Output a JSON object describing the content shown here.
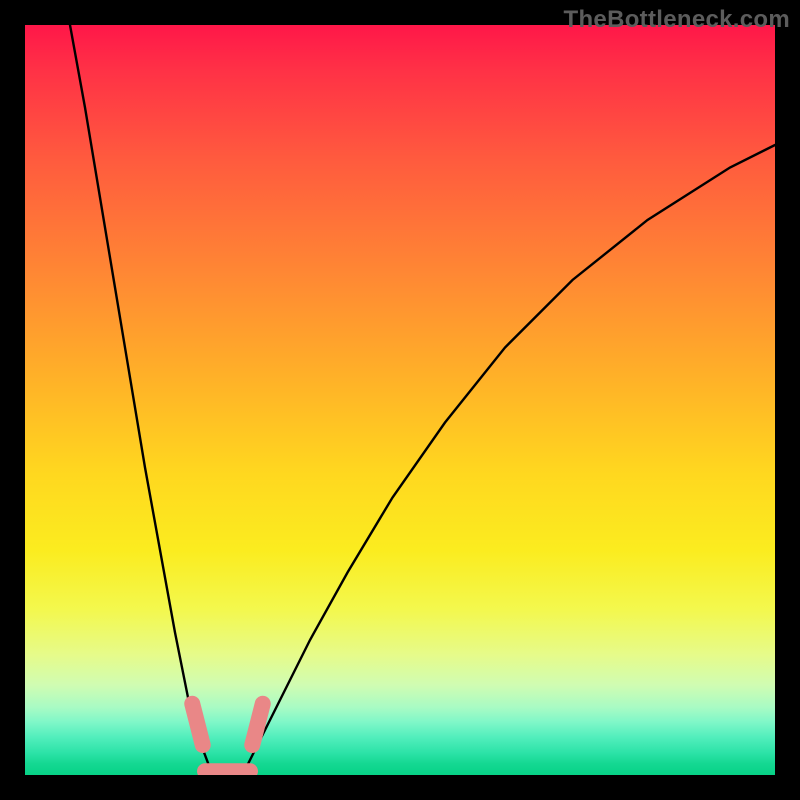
{
  "watermark": "TheBottleneck.com",
  "colors": {
    "frame": "#000000",
    "curve": "#000000",
    "marker": "#e98787"
  },
  "chart_data": {
    "type": "line",
    "title": "",
    "xlabel": "",
    "ylabel": "",
    "xlim": [
      0,
      100
    ],
    "ylim": [
      0,
      100
    ],
    "grid": false,
    "legend": false,
    "background_gradient": {
      "direction": "vertical",
      "stops": [
        {
          "pos": 0.0,
          "color": "#ff1749"
        },
        {
          "pos": 0.18,
          "color": "#ff5b3e"
        },
        {
          "pos": 0.48,
          "color": "#ffb427"
        },
        {
          "pos": 0.7,
          "color": "#fbec1f"
        },
        {
          "pos": 0.88,
          "color": "#d0fcb2"
        },
        {
          "pos": 1.0,
          "color": "#07d286"
        }
      ]
    },
    "series": [
      {
        "name": "left-branch",
        "x": [
          6,
          8,
          10,
          12,
          14,
          16,
          18,
          20,
          22,
          23.5,
          25
        ],
        "y": [
          100,
          89,
          77,
          65,
          53,
          41,
          30,
          19,
          9,
          4,
          0
        ]
      },
      {
        "name": "right-branch",
        "x": [
          29,
          31,
          34,
          38,
          43,
          49,
          56,
          64,
          73,
          83,
          94,
          100
        ],
        "y": [
          0,
          4,
          10,
          18,
          27,
          37,
          47,
          57,
          66,
          74,
          81,
          84
        ]
      }
    ],
    "markers": [
      {
        "name": "left-dip-marker",
        "shape": "capsule",
        "x0": 22.3,
        "y0": 9.5,
        "x1": 23.7,
        "y1": 4.0
      },
      {
        "name": "right-dip-marker",
        "shape": "capsule",
        "x0": 30.3,
        "y0": 4.0,
        "x1": 31.7,
        "y1": 9.5
      },
      {
        "name": "base-marker",
        "shape": "capsule",
        "x0": 24.0,
        "y0": 0.5,
        "x1": 30.0,
        "y1": 0.5
      }
    ]
  }
}
